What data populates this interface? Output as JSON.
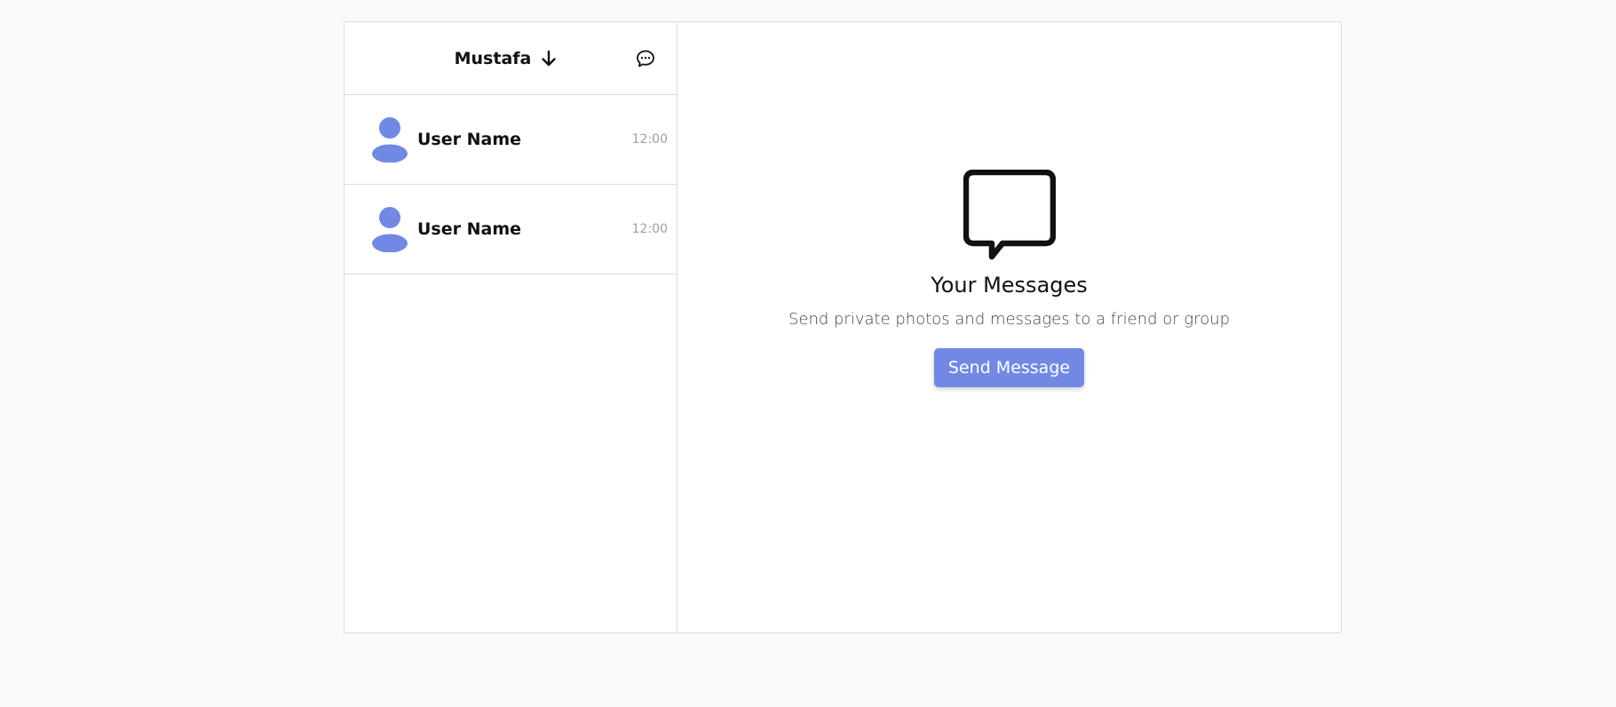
{
  "colors": {
    "accent": "#7289e3",
    "background": "#fafafa",
    "panel": "#ffffff",
    "border": "#dbdbdb",
    "muted_text": "#a0a0a0"
  },
  "sidebar": {
    "header": {
      "account_name": "Mustafa",
      "switch_icon": "arrow-down-icon",
      "new_message_icon": "chat-bubble-icon"
    },
    "conversations": [
      {
        "name": "User Name",
        "time": "12:00",
        "avatar_icon": "user-avatar-icon"
      },
      {
        "name": "User Name",
        "time": "12:00",
        "avatar_icon": "user-avatar-icon"
      }
    ]
  },
  "main": {
    "icon": "message-bubble-icon",
    "title": "Your Messages",
    "subtitle": "Send private photos and messages to a friend or group",
    "button_label": "Send Message"
  }
}
